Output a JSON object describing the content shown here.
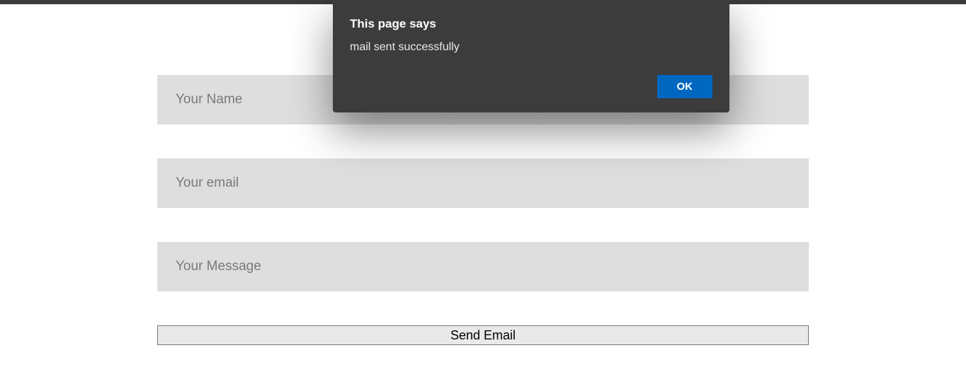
{
  "dialog": {
    "title": "This page says",
    "message": "mail sent successfully",
    "ok_label": "OK"
  },
  "form": {
    "name_placeholder": "Your Name",
    "email_placeholder": "Your email",
    "message_placeholder": "Your Message",
    "name_value": "",
    "email_value": "",
    "message_value": "",
    "submit_label": "Send Email"
  }
}
